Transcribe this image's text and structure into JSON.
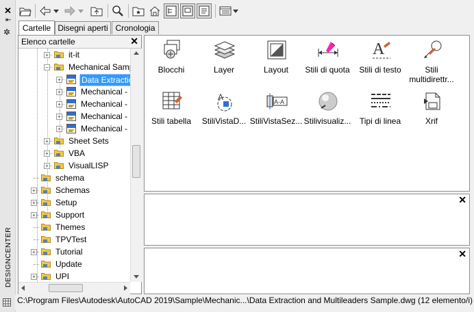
{
  "strip": {
    "vertical_title": "DESIGNCENTER"
  },
  "toolbar": {
    "buttons": [
      "load-icon",
      "back-icon",
      "dropdown-icon",
      "forward-icon",
      "dropdown-icon",
      "up-folder-icon",
      "search-icon",
      "favorites-icon",
      "home-icon",
      "tree-toggle-icon",
      "preview-icon",
      "description-icon",
      "views-icon",
      "dropdown-icon"
    ]
  },
  "tabs": [
    "Cartelle",
    "Disegni aperti",
    "Cronologia"
  ],
  "tree": {
    "title": "Elenco cartelle",
    "rows": [
      {
        "label": "it-it",
        "type": "folder"
      },
      {
        "label": "Mechanical Sampl",
        "type": "folder"
      },
      {
        "label": "Data Extractio",
        "type": "dwg",
        "selected": true
      },
      {
        "label": "Mechanical - ",
        "type": "dwg"
      },
      {
        "label": "Mechanical - ",
        "type": "dwg"
      },
      {
        "label": "Mechanical - ",
        "type": "dwg"
      },
      {
        "label": "Mechanical - ",
        "type": "dwg"
      },
      {
        "label": "Sheet Sets",
        "type": "folder"
      },
      {
        "label": "VBA",
        "type": "folder"
      },
      {
        "label": "VisualLISP",
        "type": "folder"
      },
      {
        "label": "schema",
        "type": "folder"
      },
      {
        "label": "Schemas",
        "type": "folder"
      },
      {
        "label": "Setup",
        "type": "folder"
      },
      {
        "label": "Support",
        "type": "folder"
      },
      {
        "label": "Themes",
        "type": "folder"
      },
      {
        "label": "TPVTest",
        "type": "folder"
      },
      {
        "label": "Tutorial",
        "type": "folder"
      },
      {
        "label": "Update",
        "type": "folder"
      },
      {
        "label": "UPI",
        "type": "folder"
      }
    ]
  },
  "content": {
    "items": [
      {
        "label": "Blocchi",
        "icon": "blocks-icon"
      },
      {
        "label": "Layer",
        "icon": "layers-icon"
      },
      {
        "label": "Layout",
        "icon": "layout-icon"
      },
      {
        "label": "Stili di quota",
        "icon": "dimension-style-icon"
      },
      {
        "label": "Stili di testo",
        "icon": "text-style-icon"
      },
      {
        "label": "Stili multidirettr...",
        "icon": "multileader-style-icon"
      },
      {
        "label": "Stili tabella",
        "icon": "table-style-icon"
      },
      {
        "label": "StiliVistaD...",
        "icon": "detail-view-style-icon"
      },
      {
        "label": "StiliVistaSez...",
        "icon": "section-view-style-icon"
      },
      {
        "label": "Stilivisualiz...",
        "icon": "visual-style-icon"
      },
      {
        "label": "Tipi di linea",
        "icon": "linetype-icon"
      },
      {
        "label": "Xrif",
        "icon": "xref-icon"
      }
    ]
  },
  "status": {
    "path": "C:\\Program Files\\Autodesk\\AutoCAD 2019\\Sample\\Mechanic...\\Data Extraction and Multileaders Sample.dwg (12 elemento/i)"
  },
  "colors": {
    "selection": "#3399ff",
    "folder": "#f2c94c"
  }
}
